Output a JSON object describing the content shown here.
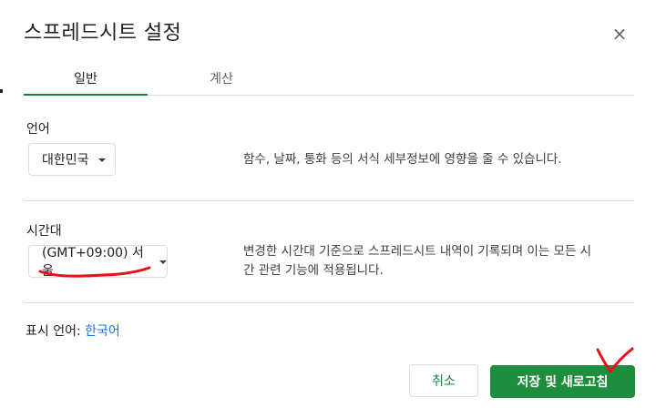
{
  "dialog": {
    "title": "스프레드시트 설정",
    "close_glyph": "×"
  },
  "tabs": [
    {
      "label": "일반",
      "active": true
    },
    {
      "label": "계산",
      "active": false
    }
  ],
  "language": {
    "label": "언어",
    "selected": "대한민국",
    "description": "함수, 날짜, 통화 등의 서식 세부정보에 영향을 줄 수 있습니다."
  },
  "timezone": {
    "label": "시간대",
    "selected": "(GMT+09:00) 서울",
    "description_line1": "변경한 시간대 기준으로 스프레드시트 내역이 기록되며 이는 모든 시",
    "description_line2": "간 관련 기능에 적용됩니다."
  },
  "display_language": {
    "label": "표시 언어:",
    "value": "한국어"
  },
  "buttons": {
    "cancel": "취소",
    "save": "저장 및 새로고침"
  },
  "colors": {
    "accent": "#188038",
    "primary_button": "#1e8e3e",
    "link": "#1a73e8",
    "annotation": "#e8101b"
  }
}
